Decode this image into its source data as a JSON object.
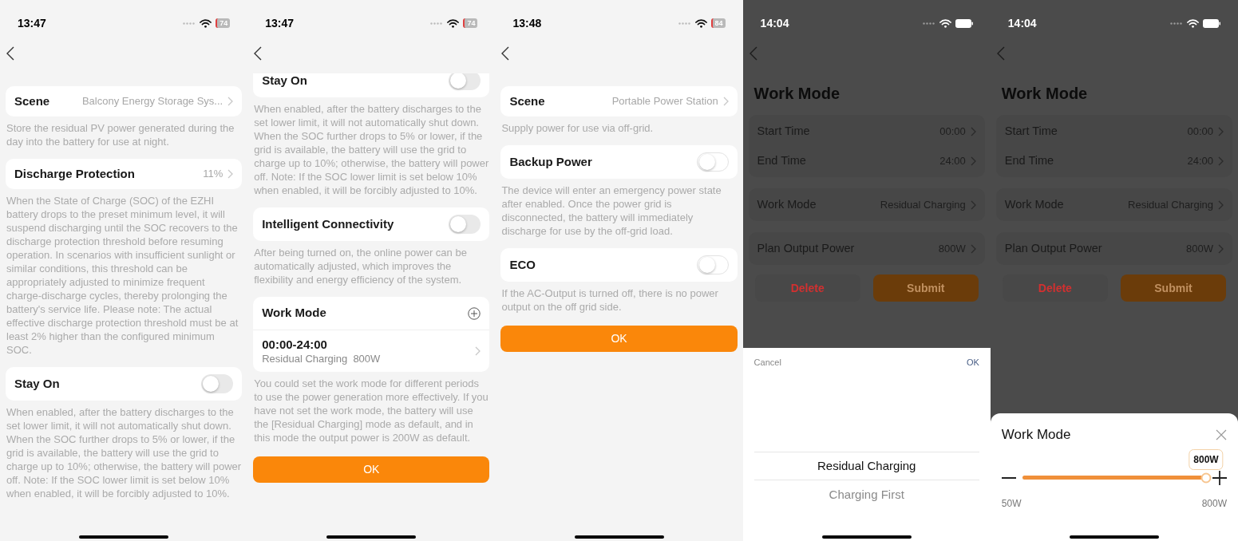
{
  "screens": [
    {
      "kind": "settings",
      "status": {
        "time": "13:47",
        "battery": "74"
      },
      "sections": [
        {
          "kind": "link",
          "label": "Scene",
          "value": "Balcony Energy Storage Sys...",
          "description": "Store the residual PV power generated during the day into the battery for use at night."
        },
        {
          "kind": "link",
          "label": "Discharge Protection",
          "value": "11%",
          "description": "When the State of Charge (SOC) of the EZHI battery drops to the preset minimum level, it will suspend discharging until the SOC recovers to the discharge protection threshold before resuming operation. In scenarios with insufficient sunlight or similar conditions, this threshold can be appropriately adjusted to minimize frequent charge-discharge cycles, thereby prolonging the battery's service life. Please note: The actual effective discharge protection threshold must be at least 2% higher than the configured minimum SOC."
        },
        {
          "kind": "toggle",
          "label": "Stay On",
          "on": false,
          "description": "When enabled, after the battery discharges to the set lower limit, it will not automatically shut down. When the SOC further drops to 5% or lower, if the grid is available, the battery will use the grid to charge up to 10%; otherwise, the battery will power off. Note: If the SOC lower limit is set below 10% when enabled, it will be forcibly adjusted to 10%."
        }
      ]
    },
    {
      "kind": "settings",
      "status": {
        "time": "13:47",
        "battery": "74"
      },
      "clipped_top": true,
      "sections": [
        {
          "kind": "toggle",
          "label": "Stay On",
          "on": false,
          "description": "When enabled, after the battery discharges to the set lower limit, it will not automatically shut down. When the SOC further drops to 5% or lower, if the grid is available, the battery will use the grid to charge up to 10%; otherwise, the battery will power off. Note: If the SOC lower limit is set below 10% when enabled, it will be forcibly adjusted to 10%."
        },
        {
          "kind": "toggle",
          "label": "Intelligent Connectivity",
          "on": false,
          "description": "After being turned on, the online power can be automatically adjusted, which improves the flexibility and energy efficiency of the system."
        },
        {
          "kind": "schedule",
          "label": "Work Mode",
          "entries": [
            {
              "time": "00:00-24:00",
              "detail": "Residual Charging  800W"
            }
          ],
          "description": "You could set the work mode for different periods to use the power generation more effectively. If you have not set the work mode, the battery will use the [Residual Charging] mode as default, and in this mode the output power is 200W as default."
        }
      ],
      "button": "OK"
    },
    {
      "kind": "settings",
      "status": {
        "time": "13:48",
        "battery": "84"
      },
      "sections": [
        {
          "kind": "link",
          "label": "Scene",
          "value": "Portable Power Station",
          "description": "Supply power for use via off-grid."
        },
        {
          "kind": "toggle",
          "label": "Backup Power",
          "on": false,
          "description": "The device will enter an emergency power state after enabled. Once the power grid is disconnected, the battery will immediately discharge for use by the off-grid load."
        },
        {
          "kind": "toggle",
          "label": "ECO",
          "on": false,
          "description": "If the AC-Output is turned off, there is no power output on the off grid side."
        }
      ],
      "button": "OK"
    },
    {
      "kind": "work_mode",
      "status": {
        "time": "14:04"
      },
      "title": "Work Mode",
      "groups": [
        [
          {
            "label": "Start Time",
            "value": "00:00"
          },
          {
            "label": "End Time",
            "value": "24:00"
          }
        ],
        [
          {
            "label": "Work Mode",
            "value": "Residual Charging"
          }
        ],
        [
          {
            "label": "Plan Output Power",
            "value": "800W"
          }
        ]
      ],
      "delete": "Delete",
      "submit": "Submit",
      "sheet": {
        "kind": "picker",
        "cancel": "Cancel",
        "ok": "OK",
        "options": [
          {
            "label": "Residual Charging",
            "selected": true
          },
          {
            "label": "Charging First",
            "selected": false
          }
        ]
      }
    },
    {
      "kind": "work_mode",
      "status": {
        "time": "14:04"
      },
      "title": "Work Mode",
      "groups": [
        [
          {
            "label": "Start Time",
            "value": "00:00"
          },
          {
            "label": "End Time",
            "value": "24:00"
          }
        ],
        [
          {
            "label": "Work Mode",
            "value": "Residual Charging"
          }
        ],
        [
          {
            "label": "Plan Output Power",
            "value": "800W"
          }
        ]
      ],
      "delete": "Delete",
      "submit": "Submit",
      "sheet": {
        "kind": "slider",
        "title": "Work Mode",
        "value_label": "800W",
        "level": 1,
        "min_label": "50W",
        "max_label": "800W"
      }
    }
  ]
}
